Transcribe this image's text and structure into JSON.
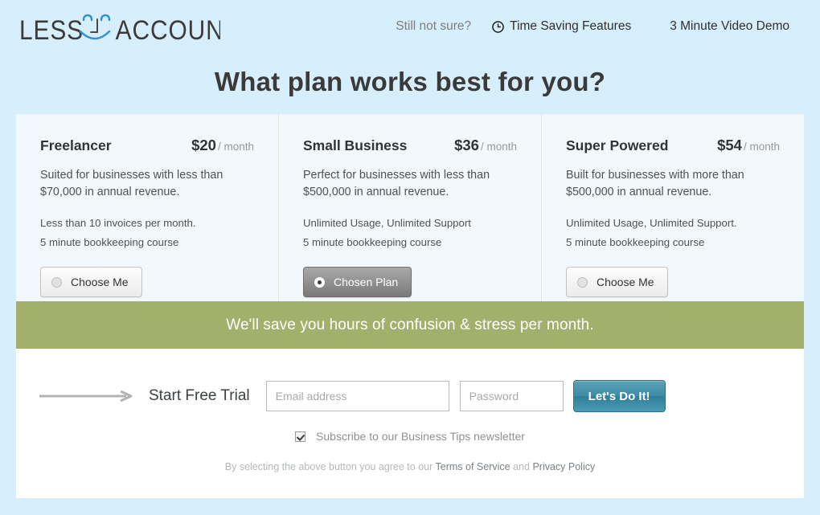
{
  "header": {
    "logo_text_left": "LESS",
    "logo_text_right": "ACCOUNTING",
    "logo_icon": "smiley-face-logo",
    "nav": {
      "still_not_sure": "Still not sure?",
      "time_saving": {
        "label": "Time Saving Features",
        "icon": "clock-icon"
      },
      "video_demo": "3 Minute Video Demo"
    }
  },
  "page_title": "What plan works best for you?",
  "plans": [
    {
      "name": "Freelancer",
      "price": "$20",
      "per": "/ month",
      "description": "Suited for businesses with less than $70,000 in annual revenue.",
      "feature_1": "Less than 10 invoices per month.",
      "feature_2": "5 minute bookkeeping course",
      "button_label": "Choose Me",
      "selected": false
    },
    {
      "name": "Small Business",
      "price": "$36",
      "per": "/ month",
      "description": "Perfect for businesses with less than $500,000 in annual revenue.",
      "feature_1": "Unlimited Usage, Unlimited Support",
      "feature_2": "5 minute bookkeeping course",
      "button_label": "Chosen Plan",
      "selected": true
    },
    {
      "name": "Super Powered",
      "price": "$54",
      "per": "/ month",
      "description": "Built for businesses with more than $500,000 in annual revenue.",
      "feature_1": "Unlimited Usage, Unlimited Support.",
      "feature_2": "5 minute bookkeeping course",
      "button_label": "Choose Me",
      "selected": false
    }
  ],
  "banner": {
    "text": "We'll save you hours of confusion & stress per month."
  },
  "signup": {
    "arrow_icon": "arrow-right-icon",
    "start_label": "Start Free Trial",
    "email_placeholder": "Email address",
    "email_value": "",
    "password_placeholder": "Password",
    "password_value": "",
    "submit_label": "Let's Do It!",
    "subscribe_label": "Subscribe to our Business Tips newsletter",
    "subscribe_checked": true,
    "legal_prefix": "By selecting the above button you agree to our ",
    "legal_terms": "Terms of Service",
    "legal_and": " and ",
    "legal_privacy": "Privacy Policy"
  },
  "colors": {
    "page_background": "#d7eefc",
    "card_background": "#f2f9fc",
    "banner_green": "#a3b06b",
    "submit_teal": "#3d8ba4",
    "logo_blue": "#2f93d4"
  }
}
